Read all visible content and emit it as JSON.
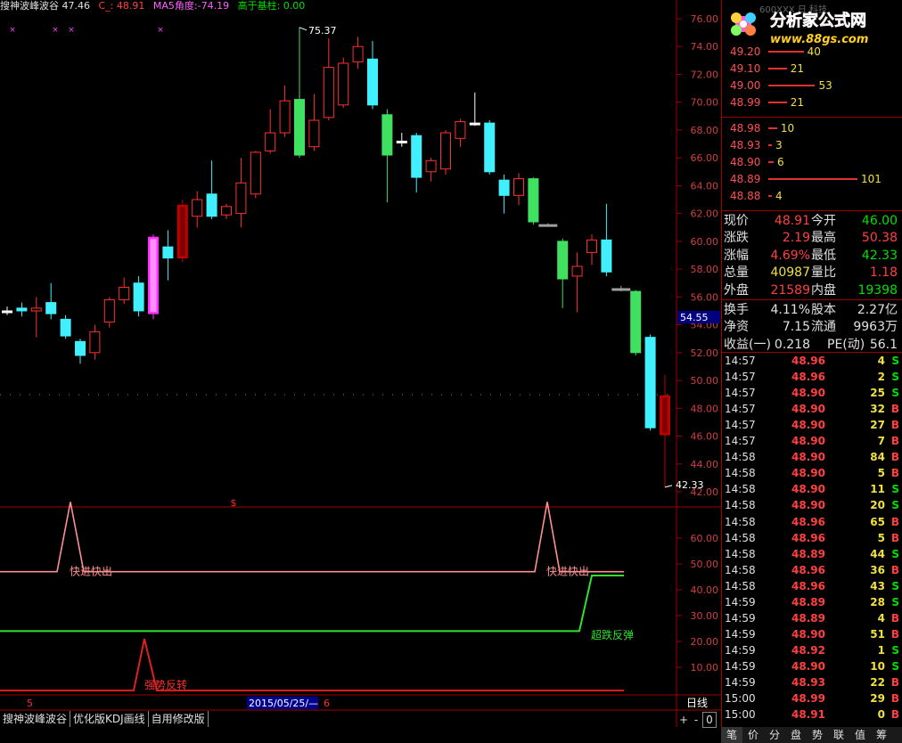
{
  "info_bar": {
    "indicator_name": "搜神波峰波谷",
    "partial_value": "47.46",
    "c_label": "C_:",
    "c_value": "48.91",
    "ma5_label": "MA5角度:",
    "ma5_value": "-74.19",
    "above_label": "高于基柱:",
    "above_value": "0.00"
  },
  "price_axis": {
    "ticks": [
      "76.00",
      "74.00",
      "72.00",
      "70.00",
      "68.00",
      "66.00",
      "64.00",
      "62.00",
      "60.00",
      "58.00",
      "56.00",
      "54.00",
      "52.00",
      "50.00",
      "48.00",
      "46.00",
      "44.00",
      "42.00"
    ],
    "cursor_label": "54.55"
  },
  "annotations": {
    "high": "75.37",
    "low": "42.33",
    "dollar_marker": "$"
  },
  "indicator_axis": {
    "ticks": [
      "60.00",
      "50.00",
      "40.00",
      "30.00",
      "20.00",
      "10.00"
    ]
  },
  "indicator_labels": {
    "quick_1": "快进快出",
    "quick_2": "快进快出",
    "rebound": "超跌反弹",
    "strong": "强势反转"
  },
  "date_bar": {
    "left_num": "5",
    "date": "2015/05/25/—",
    "right_num": "6",
    "period": "日线"
  },
  "bottom_tabs": [
    "搜神波峰波谷",
    "优化版KDJ画线",
    "自用修改版"
  ],
  "bottom_controls": [
    "+",
    "-",
    "0"
  ],
  "logo": {
    "title": "分析家公式网",
    "url": "www.88gs.com",
    "behind_text": "600XXX 日  科技"
  },
  "order_book": {
    "sell": [
      {
        "price": "49.20",
        "vol": "40"
      },
      {
        "price": "49.10",
        "vol": "21"
      },
      {
        "price": "49.00",
        "vol": "53"
      },
      {
        "price": "48.99",
        "vol": "21"
      }
    ],
    "buy": [
      {
        "price": "48.98",
        "vol": "10"
      },
      {
        "price": "48.93",
        "vol": "3"
      },
      {
        "price": "48.90",
        "vol": "6"
      },
      {
        "price": "48.89",
        "vol": "101"
      },
      {
        "price": "48.88",
        "vol": "4"
      }
    ]
  },
  "quote": [
    {
      "l1": "现价",
      "v1": "48.91",
      "c1": "red",
      "l2": "今开",
      "v2": "46.00",
      "c2": "green"
    },
    {
      "l1": "涨跌",
      "v1": "2.19",
      "c1": "red",
      "l2": "最高",
      "v2": "50.38",
      "c2": "red"
    },
    {
      "l1": "涨幅",
      "v1": "4.69%",
      "c1": "red",
      "l2": "最低",
      "v2": "42.33",
      "c2": "green"
    },
    {
      "l1": "总量",
      "v1": "40987",
      "c1": "yellow",
      "l2": "量比",
      "v2": "1.18",
      "c2": "red"
    },
    {
      "l1": "外盘",
      "v1": "21589",
      "c1": "red",
      "l2": "内盘",
      "v2": "19398",
      "c2": "green"
    },
    {
      "l1": "换手",
      "v1": "4.11%",
      "c1": "white",
      "l2": "股本",
      "v2": "2.27亿",
      "c2": "white"
    },
    {
      "l1": "净资",
      "v1": "7.15",
      "c1": "white",
      "l2": "流通",
      "v2": "9963万",
      "c2": "white"
    },
    {
      "l1": "收益(一)",
      "v1": "0.218",
      "c1": "white",
      "l2": "PE(动)",
      "v2": "56.1",
      "c2": "white"
    }
  ],
  "ticks": [
    {
      "time": "14:57",
      "price": "48.96",
      "vol": "4",
      "dir": "S"
    },
    {
      "time": "14:57",
      "price": "48.96",
      "vol": "2",
      "dir": "S"
    },
    {
      "time": "14:57",
      "price": "48.90",
      "vol": "25",
      "dir": "S"
    },
    {
      "time": "14:57",
      "price": "48.90",
      "vol": "32",
      "dir": "B"
    },
    {
      "time": "14:57",
      "price": "48.90",
      "vol": "27",
      "dir": "B"
    },
    {
      "time": "14:57",
      "price": "48.90",
      "vol": "7",
      "dir": "B"
    },
    {
      "time": "14:58",
      "price": "48.90",
      "vol": "84",
      "dir": "B"
    },
    {
      "time": "14:58",
      "price": "48.90",
      "vol": "5",
      "dir": "B"
    },
    {
      "time": "14:58",
      "price": "48.90",
      "vol": "11",
      "dir": "S"
    },
    {
      "time": "14:58",
      "price": "48.90",
      "vol": "20",
      "dir": "S"
    },
    {
      "time": "14:58",
      "price": "48.96",
      "vol": "65",
      "dir": "B"
    },
    {
      "time": "14:58",
      "price": "48.96",
      "vol": "5",
      "dir": "B"
    },
    {
      "time": "14:58",
      "price": "48.89",
      "vol": "44",
      "dir": "S"
    },
    {
      "time": "14:58",
      "price": "48.96",
      "vol": "36",
      "dir": "B"
    },
    {
      "time": "14:58",
      "price": "48.96",
      "vol": "43",
      "dir": "S"
    },
    {
      "time": "14:59",
      "price": "48.89",
      "vol": "28",
      "dir": "S"
    },
    {
      "time": "14:59",
      "price": "48.89",
      "vol": "4",
      "dir": "B"
    },
    {
      "time": "14:59",
      "price": "48.90",
      "vol": "51",
      "dir": "B"
    },
    {
      "time": "14:59",
      "price": "48.92",
      "vol": "1",
      "dir": "S"
    },
    {
      "time": "14:59",
      "price": "48.90",
      "vol": "10",
      "dir": "S"
    },
    {
      "time": "14:59",
      "price": "48.93",
      "vol": "22",
      "dir": "B"
    },
    {
      "time": "15:00",
      "price": "48.99",
      "vol": "29",
      "dir": "B"
    },
    {
      "time": "15:00",
      "price": "48.91",
      "vol": "0",
      "dir": "B"
    }
  ],
  "panel_tabs": [
    "笔",
    "价",
    "分",
    "盘",
    "势",
    "联",
    "值",
    "筹"
  ],
  "chart_data": {
    "type": "candlestick",
    "ylim": [
      41,
      77
    ],
    "candles": [
      {
        "o": 55.0,
        "c": 55.0,
        "h": 55.3,
        "l": 54.7,
        "color": "white"
      },
      {
        "o": 55.0,
        "c": 55.2,
        "h": 55.6,
        "l": 54.6,
        "color": "cyan"
      },
      {
        "o": 55.0,
        "c": 55.2,
        "h": 56.0,
        "l": 53.1,
        "color": "red"
      },
      {
        "o": 55.6,
        "c": 54.8,
        "h": 57.0,
        "l": 54.4,
        "color": "cyan"
      },
      {
        "o": 54.4,
        "c": 53.2,
        "h": 54.7,
        "l": 53.0,
        "color": "cyan"
      },
      {
        "o": 52.8,
        "c": 51.8,
        "h": 53.0,
        "l": 51.2,
        "color": "cyan"
      },
      {
        "o": 52.0,
        "c": 53.5,
        "h": 54.0,
        "l": 51.5,
        "color": "red"
      },
      {
        "o": 54.2,
        "c": 55.8,
        "h": 56.0,
        "l": 53.8,
        "color": "red"
      },
      {
        "o": 55.8,
        "c": 56.7,
        "h": 57.4,
        "l": 55.5,
        "color": "red"
      },
      {
        "o": 57.0,
        "c": 55.0,
        "h": 57.5,
        "l": 54.6,
        "color": "cyan"
      },
      {
        "o": 54.8,
        "c": 60.3,
        "h": 60.5,
        "l": 54.4,
        "color": "magenta"
      },
      {
        "o": 59.6,
        "c": 58.8,
        "h": 60.8,
        "l": 57.2,
        "color": "cyan"
      },
      {
        "o": 58.8,
        "c": 62.6,
        "h": 63.0,
        "l": 58.5,
        "color": "darkred"
      },
      {
        "o": 61.8,
        "c": 63.0,
        "h": 63.6,
        "l": 61.0,
        "color": "red"
      },
      {
        "o": 63.4,
        "c": 61.8,
        "h": 65.8,
        "l": 61.6,
        "color": "cyan"
      },
      {
        "o": 61.9,
        "c": 62.5,
        "h": 62.7,
        "l": 61.6,
        "color": "red"
      },
      {
        "o": 62.0,
        "c": 64.2,
        "h": 66.0,
        "l": 61.0,
        "color": "red"
      },
      {
        "o": 63.4,
        "c": 66.4,
        "h": 66.5,
        "l": 63.1,
        "color": "red"
      },
      {
        "o": 66.5,
        "c": 67.8,
        "h": 69.5,
        "l": 66.3,
        "color": "red"
      },
      {
        "o": 67.8,
        "c": 70.1,
        "h": 71.2,
        "l": 67.5,
        "color": "red"
      },
      {
        "o": 70.2,
        "c": 66.2,
        "h": 75.4,
        "l": 66.0,
        "color": "green"
      },
      {
        "o": 66.8,
        "c": 68.7,
        "h": 70.6,
        "l": 66.5,
        "color": "red"
      },
      {
        "o": 68.9,
        "c": 72.5,
        "h": 74.6,
        "l": 68.7,
        "color": "red"
      },
      {
        "o": 69.8,
        "c": 72.8,
        "h": 73.2,
        "l": 69.6,
        "color": "red"
      },
      {
        "o": 72.9,
        "c": 74.0,
        "h": 74.7,
        "l": 72.4,
        "color": "red"
      },
      {
        "o": 73.1,
        "c": 69.8,
        "h": 74.4,
        "l": 69.5,
        "color": "cyan"
      },
      {
        "o": 69.1,
        "c": 66.2,
        "h": 69.5,
        "l": 62.8,
        "color": "green"
      },
      {
        "o": 67.2,
        "c": 67.2,
        "h": 67.8,
        "l": 66.8,
        "color": "white"
      },
      {
        "o": 67.6,
        "c": 64.6,
        "h": 67.8,
        "l": 63.5,
        "color": "cyan"
      },
      {
        "o": 65.0,
        "c": 65.8,
        "h": 66.0,
        "l": 64.3,
        "color": "red"
      },
      {
        "o": 65.2,
        "c": 67.8,
        "h": 68.0,
        "l": 64.8,
        "color": "red"
      },
      {
        "o": 67.4,
        "c": 68.6,
        "h": 68.8,
        "l": 66.8,
        "color": "red"
      },
      {
        "o": 68.5,
        "c": 68.5,
        "h": 70.7,
        "l": 68.3,
        "color": "white"
      },
      {
        "o": 68.5,
        "c": 65.0,
        "h": 68.7,
        "l": 64.8,
        "color": "cyan"
      },
      {
        "o": 64.4,
        "c": 63.3,
        "h": 64.8,
        "l": 62.0,
        "color": "cyan"
      },
      {
        "o": 63.3,
        "c": 64.5,
        "h": 64.9,
        "l": 62.6,
        "color": "red"
      },
      {
        "o": 64.5,
        "c": 61.4,
        "h": 64.6,
        "l": 61.2,
        "color": "green"
      },
      {
        "o": 61.2,
        "c": 61.2,
        "h": 61.3,
        "l": 61.1,
        "color": "gray"
      },
      {
        "o": 60.0,
        "c": 57.3,
        "h": 60.2,
        "l": 55.2,
        "color": "green"
      },
      {
        "o": 57.5,
        "c": 58.2,
        "h": 59.2,
        "l": 54.9,
        "color": "red"
      },
      {
        "o": 59.2,
        "c": 60.1,
        "h": 60.5,
        "l": 58.3,
        "color": "red"
      },
      {
        "o": 60.1,
        "c": 57.8,
        "h": 62.7,
        "l": 57.5,
        "color": "cyan"
      },
      {
        "o": 56.6,
        "c": 56.6,
        "h": 56.8,
        "l": 56.4,
        "color": "gray"
      },
      {
        "o": 56.4,
        "c": 52.0,
        "h": 56.5,
        "l": 51.8,
        "color": "green"
      },
      {
        "o": 53.1,
        "c": 46.6,
        "h": 53.3,
        "l": 46.4,
        "color": "cyan"
      },
      {
        "o": 48.9,
        "c": 46.1,
        "h": 50.4,
        "l": 42.3,
        "color": "darkred"
      }
    ]
  }
}
